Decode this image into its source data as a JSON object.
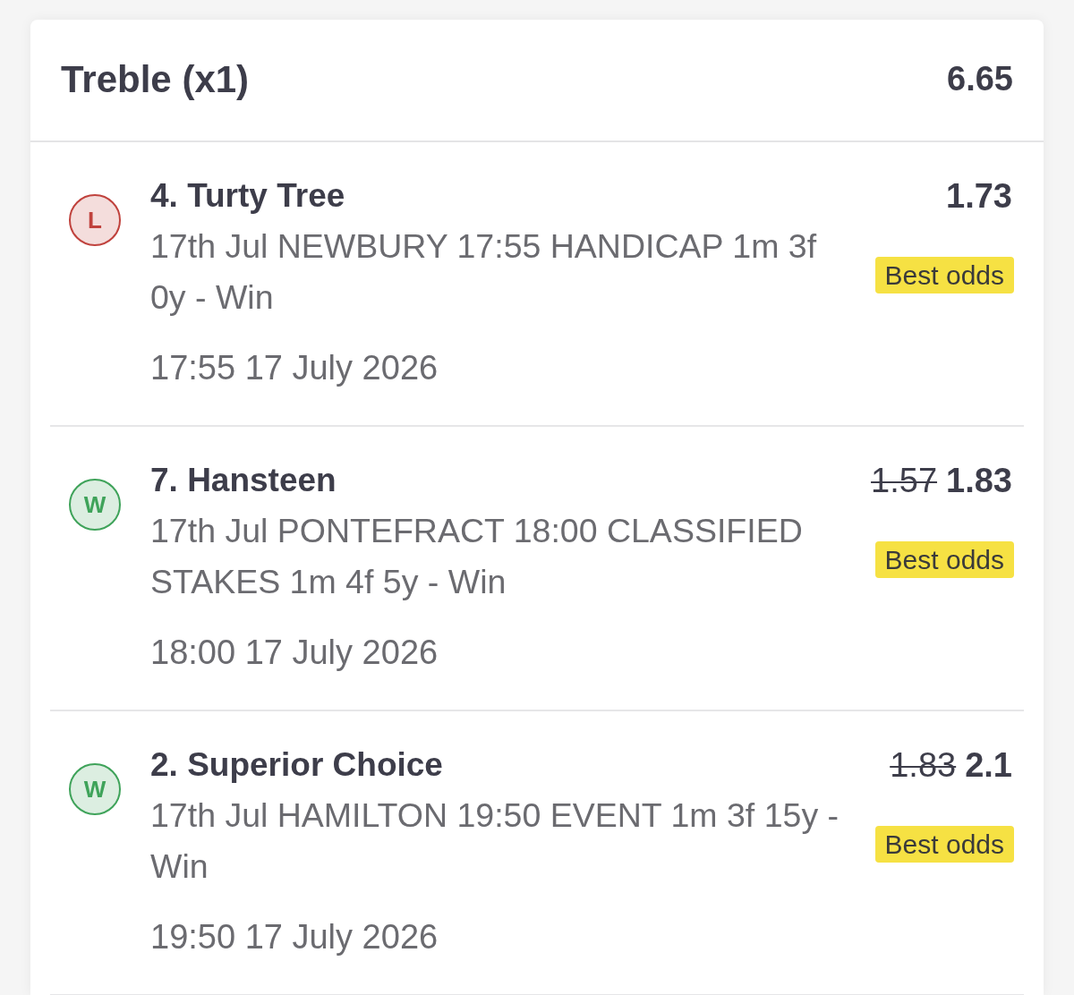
{
  "bet": {
    "title": "Treble (x1)",
    "total_odds": "6.65"
  },
  "legs": [
    {
      "result_label": "L",
      "color": "#c0423d",
      "name": "4. Turty Tree",
      "description": "17th Jul NEWBURY 17:55 HANDICAP 1m 3f 0y - Win",
      "time": "17:55 17 July 2026",
      "odds": "1.73",
      "badge": "Best odds"
    },
    {
      "result_label": "W",
      "color": "#3fa35a",
      "name": "7. Hansteen",
      "description": "17th Jul PONTEFRACT 18:00 CLASSIFIED STAKES 1m 4f 5y - Win",
      "time": "18:00 17 July 2026",
      "previous_odds": "1.57",
      "odds": "1.83",
      "badge": "Best odds"
    },
    {
      "result_label": "W",
      "color": "#3fa35a",
      "name": "2. Superior Choice",
      "description": "17th Jul HAMILTON 19:50 EVENT 1m 3f 15y - Win",
      "time": "19:50 17 July 2026",
      "previous_odds": "1.83",
      "odds": "2.1",
      "badge": "Best odds"
    }
  ]
}
